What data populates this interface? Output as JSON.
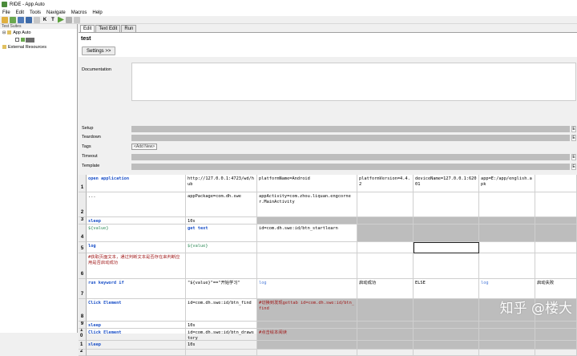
{
  "window": {
    "title": "RIDE - App Auto"
  },
  "menu": [
    "File",
    "Edit",
    "Tools",
    "Navigate",
    "Macros",
    "Help"
  ],
  "tree": {
    "header": "Test Suites",
    "root": "App Auto",
    "external": "External Resources"
  },
  "tabs": [
    "Edit",
    "Text Edit",
    "Run"
  ],
  "editor": {
    "name": "test",
    "settings_button": "Settings >>",
    "labels": {
      "documentation": "Documentation",
      "setup": "Setup",
      "teardown": "Teardown",
      "tags": "Tags",
      "timeout": "Timeout",
      "template": "Template"
    },
    "add_new": "<Add New>",
    "side_labels": {
      "edit": "E",
      "clear": "C"
    }
  },
  "grid_rows": [
    {
      "n": "1",
      "c": [
        [
          "open application",
          "kw"
        ],
        [
          "http://127.0.0.1:4723/wd/hub",
          ""
        ],
        [
          "platformName=Android",
          ""
        ],
        [
          "platformVersion=4.4.2",
          ""
        ],
        [
          "deviceName=127.0.0.1:62001",
          ""
        ],
        [
          "app=E:/app/english.apk",
          ""
        ],
        [
          "",
          ""
        ]
      ]
    },
    {
      "n": "2",
      "c": [
        [
          "...",
          ""
        ],
        [
          "appPackage=com.dh.swe",
          ""
        ],
        [
          "appActivity=com.zhou.liquan.engcorner.MainActivity",
          ""
        ],
        [
          "",
          ""
        ],
        [
          "",
          ""
        ],
        [
          "",
          ""
        ],
        [
          "",
          ""
        ]
      ]
    },
    {
      "n": "3",
      "c": [
        [
          "sleep",
          "kw"
        ],
        [
          "10s",
          ""
        ],
        [
          "",
          "g"
        ],
        [
          "",
          "g"
        ],
        [
          "",
          "g"
        ],
        [
          "",
          "g"
        ],
        [
          "",
          "g"
        ]
      ]
    },
    {
      "n": "4",
      "c": [
        [
          "${value}",
          "var"
        ],
        [
          "get text",
          "kw"
        ],
        [
          "id=com.dh.swe:id/btn_startlearn",
          ""
        ],
        [
          "",
          "g"
        ],
        [
          "",
          "g"
        ],
        [
          "",
          "g"
        ],
        [
          "",
          "g"
        ]
      ]
    },
    {
      "n": "5",
      "c": [
        [
          "log",
          "kw"
        ],
        [
          "${value}",
          "var"
        ],
        [
          "",
          ""
        ],
        [
          "",
          ""
        ],
        [
          "",
          "s"
        ],
        [
          "",
          ""
        ],
        [
          "",
          ""
        ]
      ]
    },
    {
      "n": "6",
      "c": [
        [
          "#获取页面文本，通过判断文本是否存在来判断应用是否启动成功",
          "cmt"
        ],
        [
          "",
          ""
        ],
        [
          "",
          ""
        ],
        [
          "",
          ""
        ],
        [
          "",
          ""
        ],
        [
          "",
          ""
        ],
        [
          "",
          ""
        ]
      ]
    },
    {
      "n": "7",
      "c": [
        [
          "run keyword if",
          "kw"
        ],
        [
          "\"${value}\"==\"开始学习\"",
          ""
        ],
        [
          "log",
          "hl"
        ],
        [
          "启动成功",
          ""
        ],
        [
          "ELSE",
          ""
        ],
        [
          "log",
          "hl"
        ],
        [
          "启动失败",
          ""
        ]
      ]
    },
    {
      "n": "8",
      "c": [
        [
          "Click Element",
          "kw"
        ],
        [
          "id=com.dh.swe:id/btn_find",
          ""
        ],
        [
          "#切换到发现gettab id=com.dh.swe:id/btn_find",
          "cmt g"
        ],
        [
          "",
          "g"
        ],
        [
          "",
          "g"
        ],
        [
          "",
          "g"
        ],
        [
          "",
          "g"
        ]
      ]
    },
    {
      "n": "9",
      "c": [
        [
          "sleep",
          "kw"
        ],
        [
          "10s",
          ""
        ],
        [
          "",
          "g"
        ],
        [
          "",
          "g"
        ],
        [
          "",
          "g"
        ],
        [
          "",
          "g"
        ],
        [
          "",
          "g"
        ]
      ]
    },
    {
      "n": "10",
      "c": [
        [
          "Click Element",
          "kw"
        ],
        [
          "id=com.dh.swe:id/btn_drawstory",
          ""
        ],
        [
          "#点击绘本阅读",
          "cmt g"
        ],
        [
          "",
          "g"
        ],
        [
          "",
          "g"
        ],
        [
          "",
          "g"
        ],
        [
          "",
          "g"
        ]
      ]
    },
    {
      "n": "11",
      "c": [
        [
          "sleep",
          "kw"
        ],
        [
          "10s",
          ""
        ],
        [
          "",
          "g"
        ],
        [
          "",
          "g"
        ],
        [
          "",
          "g"
        ],
        [
          "",
          "g"
        ],
        [
          "",
          "g"
        ]
      ]
    },
    {
      "n": "12",
      "c": [
        [
          "",
          ""
        ],
        [
          "",
          ""
        ],
        [
          "",
          ""
        ],
        [
          "",
          ""
        ],
        [
          "",
          ""
        ],
        [
          "",
          ""
        ],
        [
          "",
          ""
        ]
      ]
    }
  ],
  "watermark": "知乎 @楼大"
}
